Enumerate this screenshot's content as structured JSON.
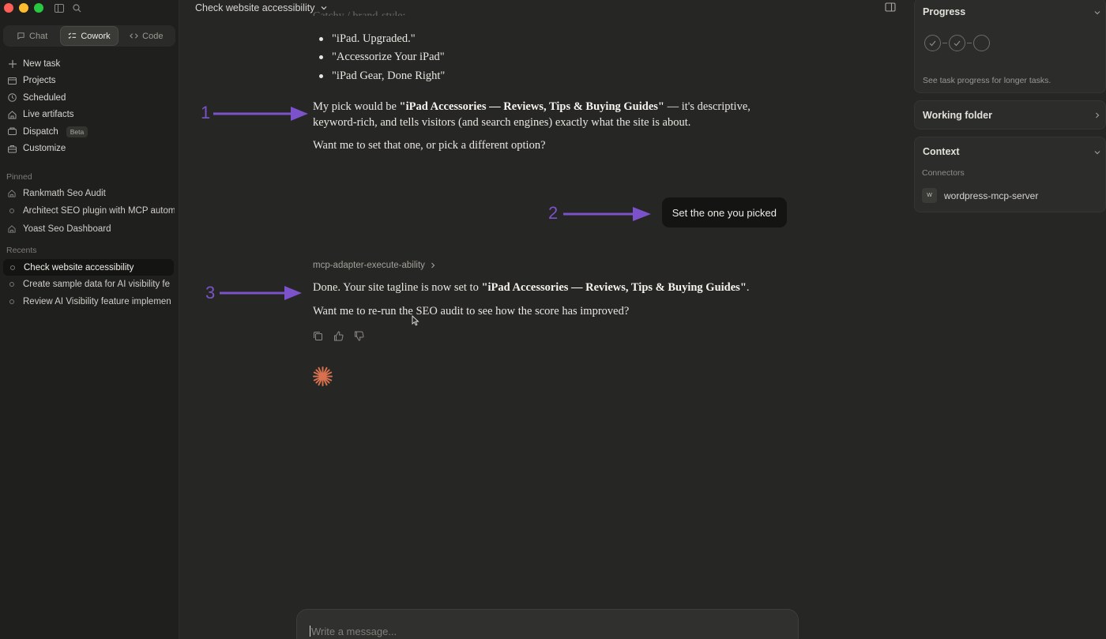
{
  "sidebar": {
    "modes": [
      {
        "label": "Chat",
        "icon": "chat-bubble-icon"
      },
      {
        "label": "Cowork",
        "icon": "checklist-icon",
        "active": true
      },
      {
        "label": "Code",
        "icon": "code-brackets-icon"
      }
    ],
    "nav": [
      {
        "label": "New task",
        "icon": "plus-icon"
      },
      {
        "label": "Projects",
        "icon": "folder-icon"
      },
      {
        "label": "Scheduled",
        "icon": "clock-icon"
      },
      {
        "label": "Live artifacts",
        "icon": "artifact-icon"
      },
      {
        "label": "Dispatch",
        "icon": "dispatch-icon",
        "badge": "Beta"
      },
      {
        "label": "Customize",
        "icon": "briefcase-icon"
      }
    ],
    "pinned_label": "Pinned",
    "pinned": [
      {
        "label": "Rankmath Seo Audit",
        "icon": "artifact-icon"
      },
      {
        "label": "Architect SEO plugin with MCP autom",
        "icon": "circle-icon"
      },
      {
        "label": "Yoast Seo Dashboard",
        "icon": "artifact-icon"
      }
    ],
    "recents_label": "Recents",
    "recents": [
      {
        "label": "Check website accessibility",
        "active": true
      },
      {
        "label": "Create sample data for AI visibility fe"
      },
      {
        "label": "Review AI Visibility feature implemen"
      }
    ]
  },
  "main": {
    "title": "Check website accessibility",
    "faded_heading": "Catchy / brand-style:",
    "bullets": [
      "\"iPad. Upgraded.\"",
      "\"Accessorize Your iPad\"",
      "\"iPad Gear, Done Right\""
    ],
    "msg1_prefix": "My pick would be ",
    "msg1_bold": "\"iPad Accessories — Reviews, Tips & Buying Guides\"",
    "msg1_suffix": " — it's descriptive,",
    "msg1_line2": "keyword-rich, and tells visitors (and search engines) exactly what the site is about.",
    "msg1_question": "Want me to set that one, or pick a different option?",
    "user_message": "Set the one you picked",
    "tool_name": "mcp-adapter-execute-ability",
    "msg2_prefix": "Done. Your site tagline is now set to ",
    "msg2_bold": "\"iPad Accessories — Reviews, Tips & Buying Guides\"",
    "msg2_suffix": ".",
    "msg2_question": "Want me to re-run the SEO audit to see how the score has improved?",
    "composer_placeholder": "Write a message...",
    "annotations": [
      "1",
      "2",
      "3"
    ]
  },
  "right_panel": {
    "progress_title": "Progress",
    "progress_hint": "See task progress for longer tasks.",
    "working_folder_title": "Working folder",
    "context_title": "Context",
    "connectors_label": "Connectors",
    "connector_icon_text": "W",
    "connector_name": "wordpress-mcp-server"
  },
  "colors": {
    "accent_arrow": "#7b52c9",
    "spark": "#d9714f"
  }
}
